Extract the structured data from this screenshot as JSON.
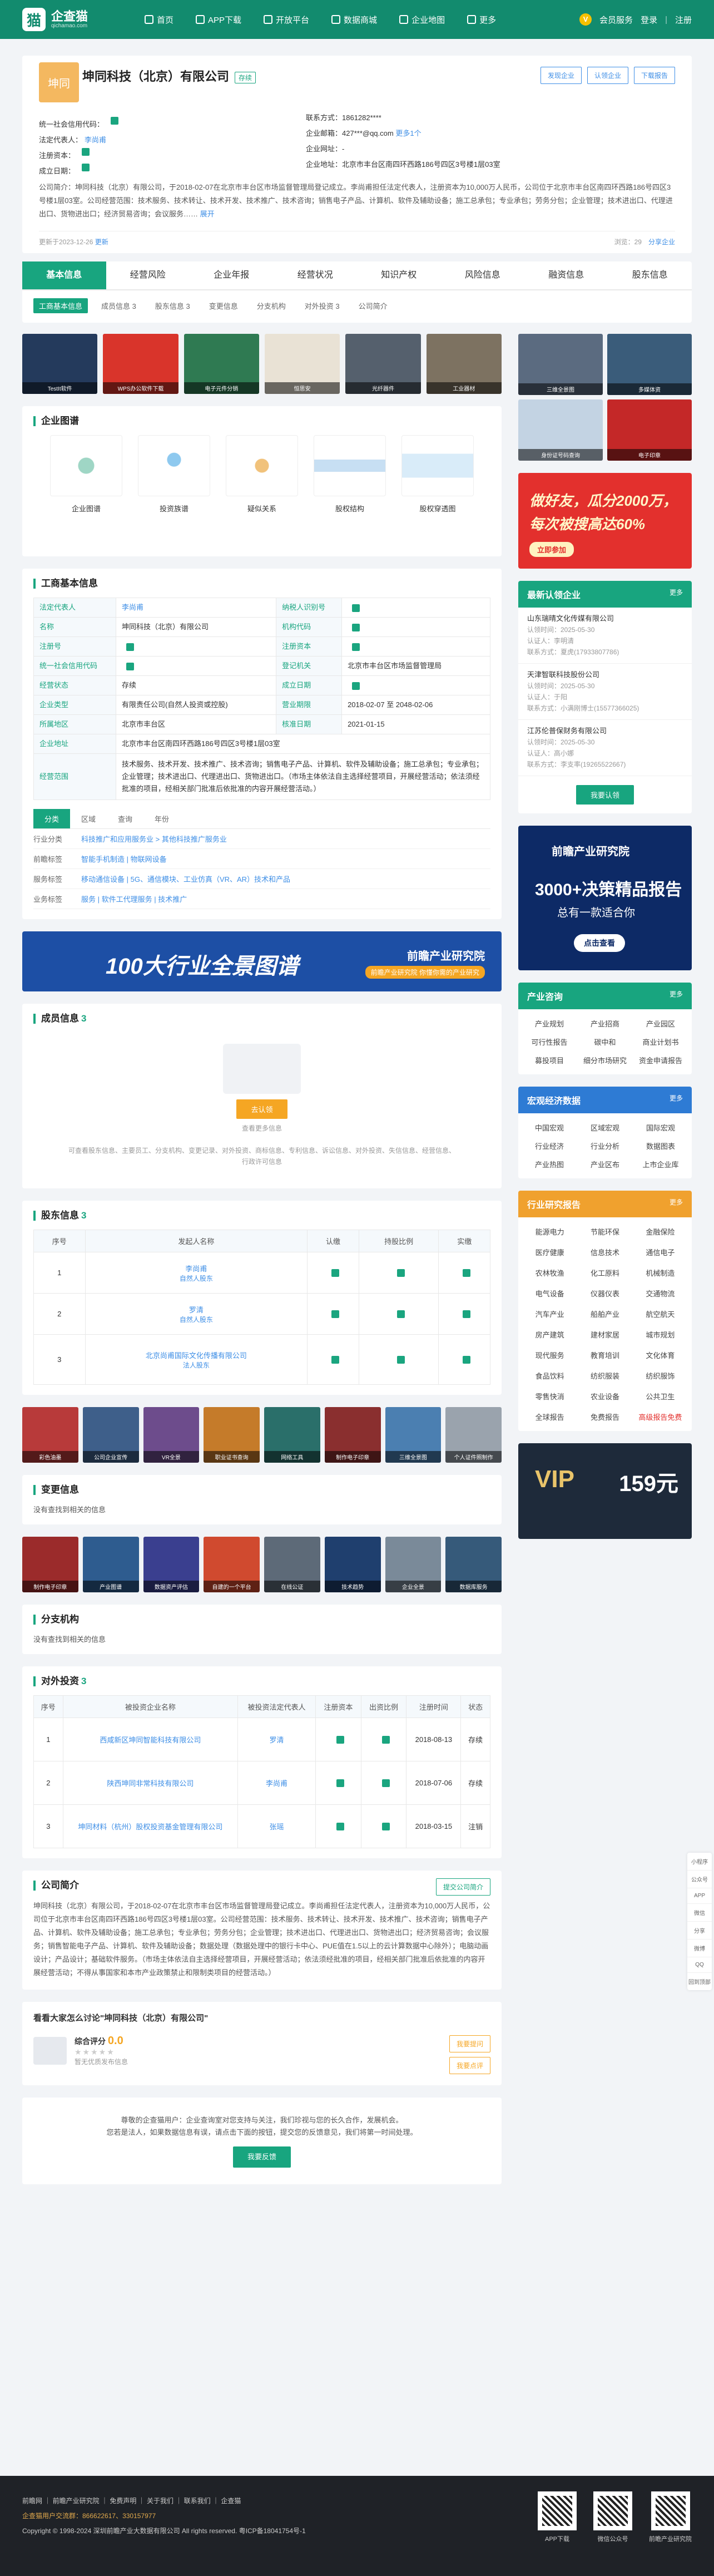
{
  "nav": {
    "logo_text": "企查猫",
    "logo_sub": "qichamao.com",
    "items": [
      "首页",
      "APP下载",
      "开放平台",
      "数据商城",
      "企业地图",
      "更多"
    ],
    "vip": "会员服务",
    "login": "登录",
    "register": "注册"
  },
  "company": {
    "logo_text": "坤同",
    "name": "坤同科技（北京）有限公司",
    "status": "存续",
    "btn_report": "发现企业",
    "btn_claim": "认领企业",
    "btn_download": "下载报告",
    "credit_code_label": "统一社会信用代码：",
    "legal_label": "法定代表人：",
    "legal_value": "李尚甫",
    "capital_label": "注册资本：",
    "date_label": "成立日期：",
    "phone_label": "联系方式：",
    "phone_value": "1861282****",
    "email_label": "企业邮箱：",
    "email_value": "427***@qq.com",
    "email_more": "更多1个",
    "site_label": "企业网址：",
    "site_value": "-",
    "addr_label": "企业地址：",
    "addr_value": "北京市丰台区南四环西路186号四区3号楼1层03室",
    "intro": "公司简介：坤同科技（北京）有限公司，于2018-02-07在北京市丰台区市场监督管理局登记成立。李尚甫担任法定代表人，注册资本为10,000万人民币，公司位于北京市丰台区南四环西路186号四区3号楼1层03室。公司经营范围：技术服务、技术转让、技术开发、技术推广、技术咨询；销售电子产品、计算机、软件及辅助设备；施工总承包；专业承包；劳务分包；企业管理；技术进出口、代理进出口、货物进出口；经济贸易咨询；会议服务……",
    "intro_more": "展开",
    "updated": "更新于2023-12-26",
    "refresh": "更新",
    "views": "浏览：29",
    "share": "分享企业"
  },
  "tabs": [
    "基本信息",
    "经营风险",
    "企业年报",
    "经营状况",
    "知识产权",
    "风险信息",
    "融资信息",
    "股东信息"
  ],
  "sub_tabs": [
    "工商基本信息",
    "成员信息 3",
    "股东信息 3",
    "变更信息",
    "分支机构",
    "对外投资 3",
    "公司简介"
  ],
  "thumbs": [
    "TestIt软件",
    "WPS办公软件下载",
    "电子元件分销",
    "恒思安",
    "光纤器件",
    "工业器材"
  ],
  "graph": {
    "title": "企业图谱",
    "items": [
      "企业图谱",
      "投资族谱",
      "疑似关系",
      "股权结构",
      "股权穿透图"
    ]
  },
  "basic": {
    "title": "工商基本信息",
    "rows": [
      [
        "法定代表人",
        "李尚甫",
        "纳税人识别号",
        ""
      ],
      [
        "名称",
        "坤同科技（北京）有限公司",
        "机构代码",
        ""
      ],
      [
        "注册号",
        "",
        "注册资本",
        ""
      ],
      [
        "统一社会信用代码",
        "",
        "登记机关",
        "北京市丰台区市场监督管理局"
      ],
      [
        "经营状态",
        "存续",
        "成立日期",
        ""
      ],
      [
        "企业类型",
        "有限责任公司(自然人投资或控股)",
        "营业期限",
        "2018-02-07 至 2048-02-06"
      ],
      [
        "所属地区",
        "北京市丰台区",
        "核准日期",
        "2021-01-15"
      ],
      [
        "企业地址",
        "北京市丰台区南四环西路186号四区3号楼1层03室",
        "",
        ""
      ],
      [
        "经营范围",
        "技术服务、技术开发、技术推广、技术咨询；销售电子产品、计算机、软件及辅助设备；施工总承包；专业承包；企业管理；技术进出口、代理进出口、货物进出口。（市场主体依法自主选择经营项目，开展经营活动；依法须经批准的项目，经相关部门批准后依批准的内容开展经营活动。）",
        "",
        ""
      ]
    ]
  },
  "industry": {
    "tabs": [
      "分类",
      "区域",
      "查询",
      "年份"
    ],
    "rows": [
      [
        "行业分类",
        "科技推广和应用服务业 > 其他科技推广服务业"
      ],
      [
        "前瞻标签",
        "智能手机制造 | 物联网设备"
      ],
      [
        "服务标签",
        "移动通信设备 | 5G、通信模块、工业仿真（VR、AR）技术和产品"
      ],
      [
        "业务标签",
        "服务 | 软件工代理服务 | 技术推广"
      ]
    ]
  },
  "banner": {
    "title": "100大行业全景图谱",
    "brand": "前瞻产业研究院",
    "sub": "前瞻产业研究院 你懂你需的产业研究"
  },
  "members": {
    "title": "成员信息",
    "count": "3",
    "btn": "去认领",
    "hint": "查看更多信息",
    "note": "可查看股东信息、主要员工、分支机构、变更记录、对外投资、商标信息、专利信息、诉讼信息、对外投资、失信信息、经营信息、行政许可信息"
  },
  "shareholders": {
    "title": "股东信息",
    "count": "3",
    "headers": [
      "序号",
      "发起人名称",
      "认缴",
      "持股比例",
      "实缴"
    ],
    "rows": [
      [
        "1",
        "李尚甫",
        "自然人股东"
      ],
      [
        "2",
        "罗清",
        "自然人股东"
      ],
      [
        "3",
        "北京尚甫国际文化传播有限公司",
        "法人股东"
      ]
    ]
  },
  "mini_thumbs": [
    "彩色油墨",
    "公司企业宣传",
    "VR全景",
    "职业证书查询",
    "网络工具",
    "制作电子印章",
    "三维全景图",
    "个人证件照制作"
  ],
  "changes": {
    "title": "变更信息",
    "empty": "没有查找到相关的信息"
  },
  "mini_thumbs2": [
    "制作电子印章",
    "产业图谱",
    "数据资产评估",
    "自建的一个平台",
    "在线公证",
    "技术趋势",
    "企业全景",
    "数据库服务"
  ],
  "branches": {
    "title": "分支机构",
    "empty": "没有查找到相关的信息"
  },
  "investments": {
    "title": "对外投资",
    "count": "3",
    "headers": [
      "序号",
      "被投资企业名称",
      "被投资法定代表人",
      "注册资本",
      "出资比例",
      "注册时间",
      "状态"
    ],
    "rows": [
      [
        "1",
        "西咸新区坤同智能科技有限公司",
        "罗清",
        "2018-08-13",
        "存续"
      ],
      [
        "2",
        "陕西坤同非常科技有限公司",
        "李尚甫",
        "2018-07-06",
        "存续"
      ],
      [
        "3",
        "坤同材料（杭州）股权投资基金管理有限公司",
        "张瑶",
        "2018-03-15",
        "注销"
      ]
    ]
  },
  "profile": {
    "title": "公司简介",
    "btn": "提交公司简介",
    "text": "坤同科技（北京）有限公司，于2018-02-07在北京市丰台区市场监督管理局登记成立。李尚甫担任法定代表人，注册资本为10,000万人民币，公司位于北京市丰台区南四环西路186号四区3号楼1层03室。公司经营范围：技术服务、技术转让、技术开发、技术推广、技术咨询；销售电子产品、计算机、软件及辅助设备；施工总承包；专业承包；劳务分包；企业管理；技术进出口、代理进出口、货物进出口；经济贸易咨询；会议服务；销售智能电子产品、计算机、软件及辅助设备；数据处理（数据处理中的银行卡中心、PUE值在1.5以上的云计算数据中心除外）；电脑动画设计；产品设计；基础软件服务。（市场主体依法自主选择经营项目，开展经营活动；依法须经批准的项目，经相关部门批准后依批准的内容开展经营活动；不得从事国家和本市产业政策禁止和限制类项目的经营活动。）"
  },
  "reviews": {
    "title": "看看大家怎么讨论\"坤同科技（北京）有限公司\"",
    "score_label": "综合评分",
    "score": "0.0",
    "note": "暂无优质发布信息",
    "btn_submit": "我要提问",
    "btn_review": "我要点评"
  },
  "claim_notice": {
    "text1": "尊敬的企查猫用户：企业查询室对您支持与关注，我们珍视与您的长久合作，发展机会。",
    "text2": "您若是法人，如果数据信息有误，请点击下面的按钮，提交您的反馈意见，我们将第一时间处理。",
    "btn": "我要反馈"
  },
  "side": {
    "promo_top_caption": "三维全景图",
    "promo_top_caption2": "多媒体资",
    "promo_top_caption3": "身份证号码查询",
    "promo_top_caption4": "电子印章",
    "ad1_line1": "做好友，瓜分2000万，",
    "ad1_line2": "每次被搜高达60%",
    "ad1_btn": "立即参加",
    "recent_title": "最新认领企业",
    "recent_more": "更多",
    "recent": [
      {
        "name": "山东瑞晴文化传媒有限公司",
        "date": "认领时间：2025-05-30",
        "person": "认证人：李明清",
        "contact": "联系方式：夏虎(17933807786)"
      },
      {
        "name": "天津智联科技股份公司",
        "date": "认领时间：2025-05-30",
        "person": "认证人：于阳",
        "contact": "联系方式：小满刚博士(15577366025)"
      },
      {
        "name": "江苏伦普保财务有限公司",
        "date": "认领时间：2025-05-30",
        "person": "认证人：高小娜",
        "contact": "联系方式：李支率(19265522667)"
      }
    ],
    "claim_btn": "我要认领",
    "ad2_brand": "前瞻产业研究院",
    "ad2_line1": "3000+决策精品报告",
    "ad2_line2": "总有一款适合你",
    "ad2_btn": "点击查看",
    "consult_title": "产业咨询",
    "consult": [
      "产业规划",
      "产业招商",
      "产业园区",
      "可行性报告",
      "碳中和",
      "商业计划书",
      "募投项目",
      "细分市场研究",
      "资金申请报告"
    ],
    "macro_title": "宏观经济数据",
    "macro": [
      "中国宏观",
      "区域宏观",
      "国际宏观",
      "行业经济",
      "行业分析",
      "数据图表",
      "产业热图",
      "产业区布",
      "上市企业库"
    ],
    "research_title": "行业研究报告",
    "research": [
      "能源电力",
      "节能环保",
      "金融保险",
      "医疗健康",
      "信息技术",
      "通信电子",
      "农林牧渔",
      "化工原料",
      "机械制造",
      "电气设备",
      "仪器仪表",
      "交通物流",
      "汽车产业",
      "船舶产业",
      "航空航天",
      "房产建筑",
      "建材家居",
      "城市规划",
      "现代服务",
      "教育培训",
      "文化体育",
      "食品饮料",
      "纺织服装",
      "纺织服饰",
      "零售快消",
      "农业设备",
      "公共卫生",
      "全球报告",
      "免费报告",
      "高级报告免费"
    ],
    "vip_price": "159元",
    "vip_label": "VIP"
  },
  "float": [
    "小程序",
    "公众号",
    "APP",
    "微信",
    "分享",
    "微博",
    "QQ",
    "回到顶部"
  ],
  "footer": {
    "links": "前瞻网 ｜ 前瞻产业研究院 ｜ 免费声明 ｜ 关于我们 ｜ 联系我们 ｜ 企查猫",
    "hotline": "企查猫用户交流群：866622617、330157977",
    "copyright": "Copyright © 1998-2024 深圳前瞻产业大数据有限公司 All rights reserved. 粤ICP备18041754号-1",
    "qr": [
      "APP下载",
      "微信公众号",
      "前瞻产业研究院"
    ]
  }
}
